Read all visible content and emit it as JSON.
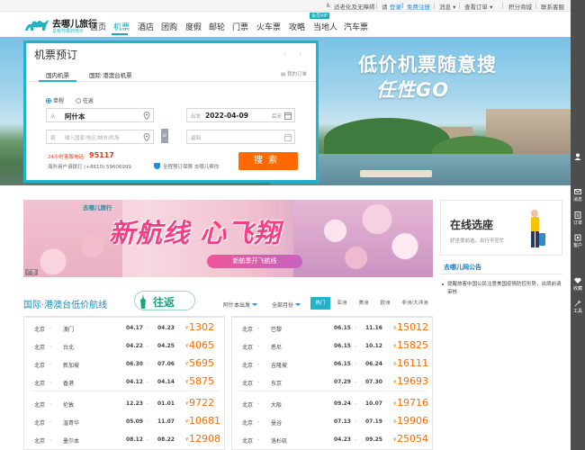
{
  "topbar": {
    "accessibility": "适老化及无障碍",
    "greeting": "请",
    "login": "登录",
    "register": "免费注册",
    "messages": "消息",
    "my_orders": "查看订单",
    "points_mall": "积分商城",
    "contact": "联系客服"
  },
  "logo": {
    "name": "去哪儿旅行",
    "slogan": "总有你要的低价"
  },
  "nav": {
    "items": [
      "首页",
      "机票",
      "酒店",
      "团购",
      "度假",
      "邮轮",
      "门票",
      "火车票",
      "攻略",
      "当地人",
      "汽车票"
    ],
    "active_index": 1,
    "vip_badge": "会员VIP"
  },
  "banner": {
    "slogan_line1": "低价机票随意搜",
    "slogan_line2": "任性GO"
  },
  "booking": {
    "title": "机票预订",
    "arrows": "‹ ›",
    "tabs": [
      "国内机票",
      "国际·港澳台机票"
    ],
    "my_orders": "我的订单",
    "trip_types": [
      "单程",
      "往返"
    ],
    "selected_trip": "单程",
    "from_label": "从",
    "from_value": "阿什本",
    "from_placeholder": "输入国家/地区/城市/机场",
    "depart_label": "出发",
    "depart_value": "2022-04-09",
    "depart_day": "后天",
    "return_label": "返回",
    "swap": "⇄",
    "hotline_label": "24小时客服电话:",
    "hotline_number": "95117",
    "overseas": "海外用户请拨打 (+8610) 59606999",
    "guarantee": "全程预订保障 去哪儿帮你",
    "search": "搜索"
  },
  "promo": {
    "brand": "去哪儿旅行",
    "headline": "新航线 心飞翔",
    "pill": "新航季开飞航线",
    "ad": "广告"
  },
  "side_banner": {
    "title": "在线选座",
    "subtitle": "好坐提前选，出行不犯忙"
  },
  "notice": {
    "title": "去哪儿网公告",
    "items": [
      "提醒旅客中国公民注意美国疫情防控形势，出境前请审核"
    ]
  },
  "lowprice": {
    "title": "国际·港澳台低价航线",
    "return_badge": "往返",
    "filter_depart": "阿什本出发",
    "filter_month": "全部月份",
    "regions": [
      "热门",
      "亚洲",
      "美洲",
      "欧洲",
      "非洲/大洋洲"
    ],
    "active_region": 0,
    "left": [
      {
        "from": "北京",
        "to": "澳门",
        "d1": "04.17",
        "d2": "04.23",
        "price": "1302"
      },
      {
        "from": "北京",
        "to": "台北",
        "d1": "04.22",
        "d2": "04.25",
        "price": "4065"
      },
      {
        "from": "北京",
        "to": "新加坡",
        "d1": "06.30",
        "d2": "07.06",
        "price": "5695"
      },
      {
        "from": "北京",
        "to": "香港",
        "d1": "04.12",
        "d2": "04.14",
        "price": "5875"
      },
      {
        "from": "北京",
        "to": "伦敦",
        "d1": "12.23",
        "d2": "01.01",
        "price": "9722"
      },
      {
        "from": "北京",
        "to": "温哥华",
        "d1": "05.09",
        "d2": "11.07",
        "price": "10681"
      },
      {
        "from": "北京",
        "to": "墨尔本",
        "d1": "08.12",
        "d2": "08.22",
        "price": "12908"
      }
    ],
    "right": [
      {
        "from": "北京",
        "to": "巴黎",
        "d1": "06.15",
        "d2": "11.16",
        "price": "15012"
      },
      {
        "from": "北京",
        "to": "悉尼",
        "d1": "06.15",
        "d2": "10.12",
        "price": "15825"
      },
      {
        "from": "北京",
        "to": "吉隆坡",
        "d1": "06.15",
        "d2": "06.24",
        "price": "16111"
      },
      {
        "from": "北京",
        "to": "东京",
        "d1": "07.29",
        "d2": "07.30",
        "price": "19693"
      },
      {
        "from": "北京",
        "to": "大阪",
        "d1": "09.24",
        "d2": "10.07",
        "price": "19716"
      },
      {
        "from": "北京",
        "to": "曼谷",
        "d1": "07.13",
        "d2": "07.19",
        "price": "19906"
      },
      {
        "from": "北京",
        "to": "洛杉矶",
        "d1": "04.23",
        "d2": "09.25",
        "price": "25054"
      }
    ],
    "yen": "¥"
  },
  "sidebar": {
    "items": [
      "消息",
      "订单",
      "客户",
      "收藏",
      "工具"
    ]
  }
}
